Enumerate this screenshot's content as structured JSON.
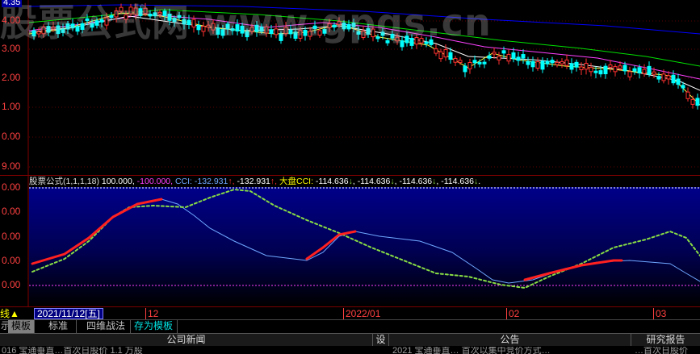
{
  "watermark": "股票公式网 www.gpqs.cn",
  "price_axis": {
    "top_label": "4.35",
    "labels": [
      "4.00",
      "3.00",
      "2.00",
      "1.00",
      "0.00",
      "9.00"
    ]
  },
  "indicator_axis": {
    "labels": [
      "0.00",
      "0.00",
      "0.00",
      "0.00",
      "0.00"
    ]
  },
  "legend": {
    "name": "股票公式(1,1,1,18)",
    "v1": "100.000,",
    "v2": "-100.000,",
    "cci_label": "CCI:",
    "cci_value": "-132.931",
    "cci_arrow": "↑",
    "cci_value2": "-132.931",
    "cci_arrow2": "↑",
    "dapan_label": "大盘CCI:",
    "dapan_v1": "-114.636",
    "dapan_a1": "↓",
    "dapan_v2": "-114.636",
    "dapan_a2": "↓",
    "dapan_v3": "-114.636",
    "dapan_a3": "↓",
    "dapan_v4": "-114.636",
    "dapan_a4": "↓"
  },
  "datebar": {
    "left_tag": "线▲",
    "current_date": "2021/11/12[五]",
    "ticks": [
      "12",
      "2022/01",
      "02",
      "03"
    ]
  },
  "tabs": {
    "t0": "示",
    "t1": "模板",
    "t2": "标准",
    "t3": "四维战法",
    "t4": "存为模板"
  },
  "infobar": {
    "news": "公司新闻",
    "set": "设",
    "notice": "公告",
    "research": "研究报告",
    "news_row": "016 宝通垂直…首次日股价  1.1 万股",
    "notice_row": "2021 宝通垂直…  首次以集中竞价方式…",
    "research_row": "…首次日股价"
  },
  "colors": {
    "up": "#ff3030",
    "down": "#00ffff",
    "cci_red": "#ff2020",
    "cci_green": "#88dd44",
    "blue_line": "#6fa8ff",
    "indicator_bg_top": "#000088",
    "indicator_bg_bottom": "#000000"
  }
}
